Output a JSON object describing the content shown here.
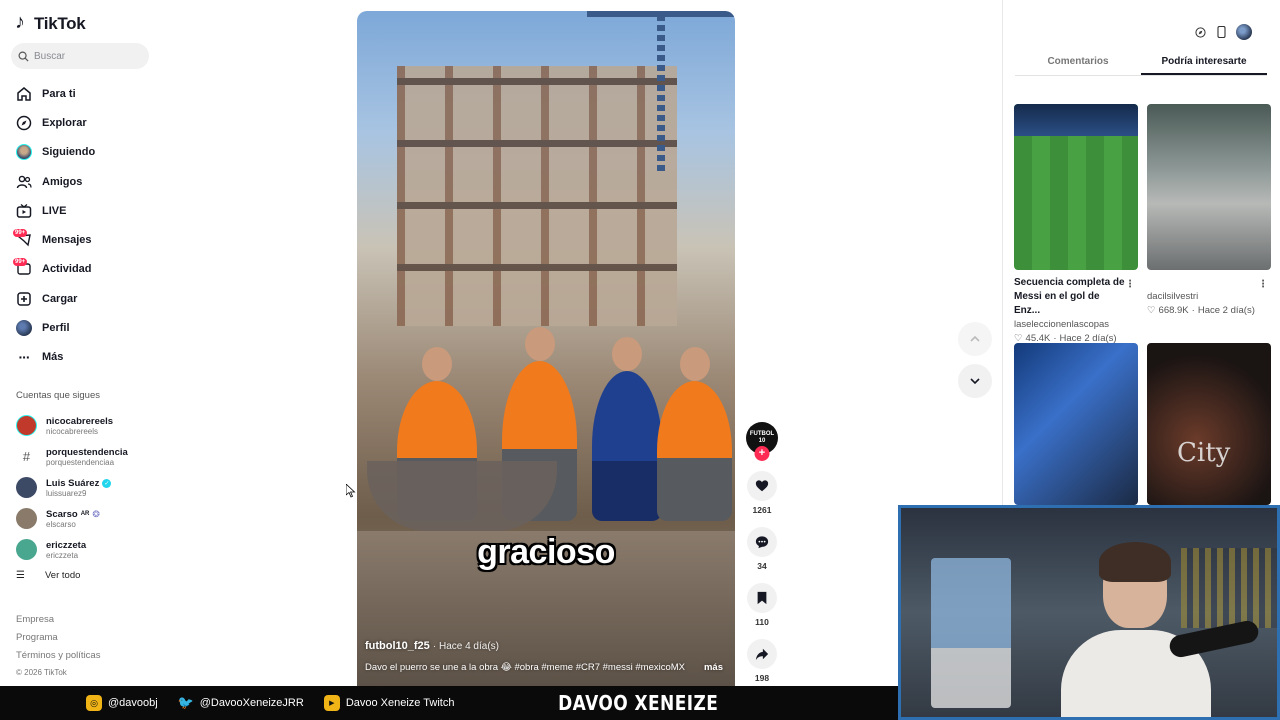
{
  "app": {
    "name": "TikTok"
  },
  "search": {
    "placeholder": "Buscar"
  },
  "nav": {
    "items": [
      {
        "label": "Para ti"
      },
      {
        "label": "Explorar"
      },
      {
        "label": "Siguiendo"
      },
      {
        "label": "Amigos"
      },
      {
        "label": "LIVE"
      },
      {
        "label": "Mensajes",
        "badge": "99+"
      },
      {
        "label": "Actividad",
        "badge": "99+"
      },
      {
        "label": "Cargar"
      },
      {
        "label": "Perfil"
      },
      {
        "label": "Más"
      }
    ]
  },
  "following": {
    "title": "Cuentas que sigues",
    "accounts": [
      {
        "name": "nicocabrereels",
        "handle": "nicocabrereels",
        "color": "#c0392b"
      },
      {
        "name": "porquestendencia",
        "handle": "porquestendenciaa",
        "color": "#ffffff"
      },
      {
        "name": "Luis Suárez",
        "handle": "luissuarez9",
        "color": "#3d4a66"
      },
      {
        "name": "Scarso",
        "handle": "elscarso",
        "suffix": "AR",
        "color": "#8a7a6a"
      },
      {
        "name": "ericzzeta",
        "handle": "ericzzeta",
        "color": "#4aa78f"
      }
    ],
    "view_all": "Ver todo"
  },
  "footer": {
    "links": [
      "Empresa",
      "Programa",
      "Términos y políticas"
    ],
    "copyright": "© 2026 TikTok"
  },
  "video": {
    "overlay_text": "gracioso",
    "author": "futbol10_f25",
    "time": "· Hace 4 día(s)",
    "description": "Davo el puerro se une a la obra 😂 #obra #meme #CR7 #messi #mexicoMX",
    "more": "más",
    "creator_badge": "FUTBOL 10",
    "likes": "1261",
    "comments": "34",
    "saves": "110",
    "shares": "198"
  },
  "right_panel": {
    "tabs": [
      {
        "label": "Comentarios",
        "active": false
      },
      {
        "label": "Podría interesarte",
        "active": true
      }
    ],
    "cards": [
      {
        "title": "Secuencia completa de Messi en el gol de Enz...",
        "user": "laseleccionenlascopas",
        "likes": "45.4K",
        "time": "Hace 2 día(s)"
      },
      {
        "title": "",
        "user": "dacilsilvestri",
        "likes": "668.9K",
        "time": "Hace 2 día(s)"
      },
      {
        "title": "",
        "user": "",
        "likes": "",
        "time": ""
      },
      {
        "title": "",
        "user": "",
        "likes": "",
        "time": ""
      }
    ]
  },
  "stream": {
    "instagram": "@davoobj",
    "twitter": "@DavooXeneizeJRR",
    "youtube": "Davoo Xeneize Twitch",
    "brand": "DAVOO XENEIZE"
  },
  "colors": {
    "accent": "#fe2c55",
    "cyan": "#25f4ee",
    "webcam_border": "#2d6fb0"
  }
}
